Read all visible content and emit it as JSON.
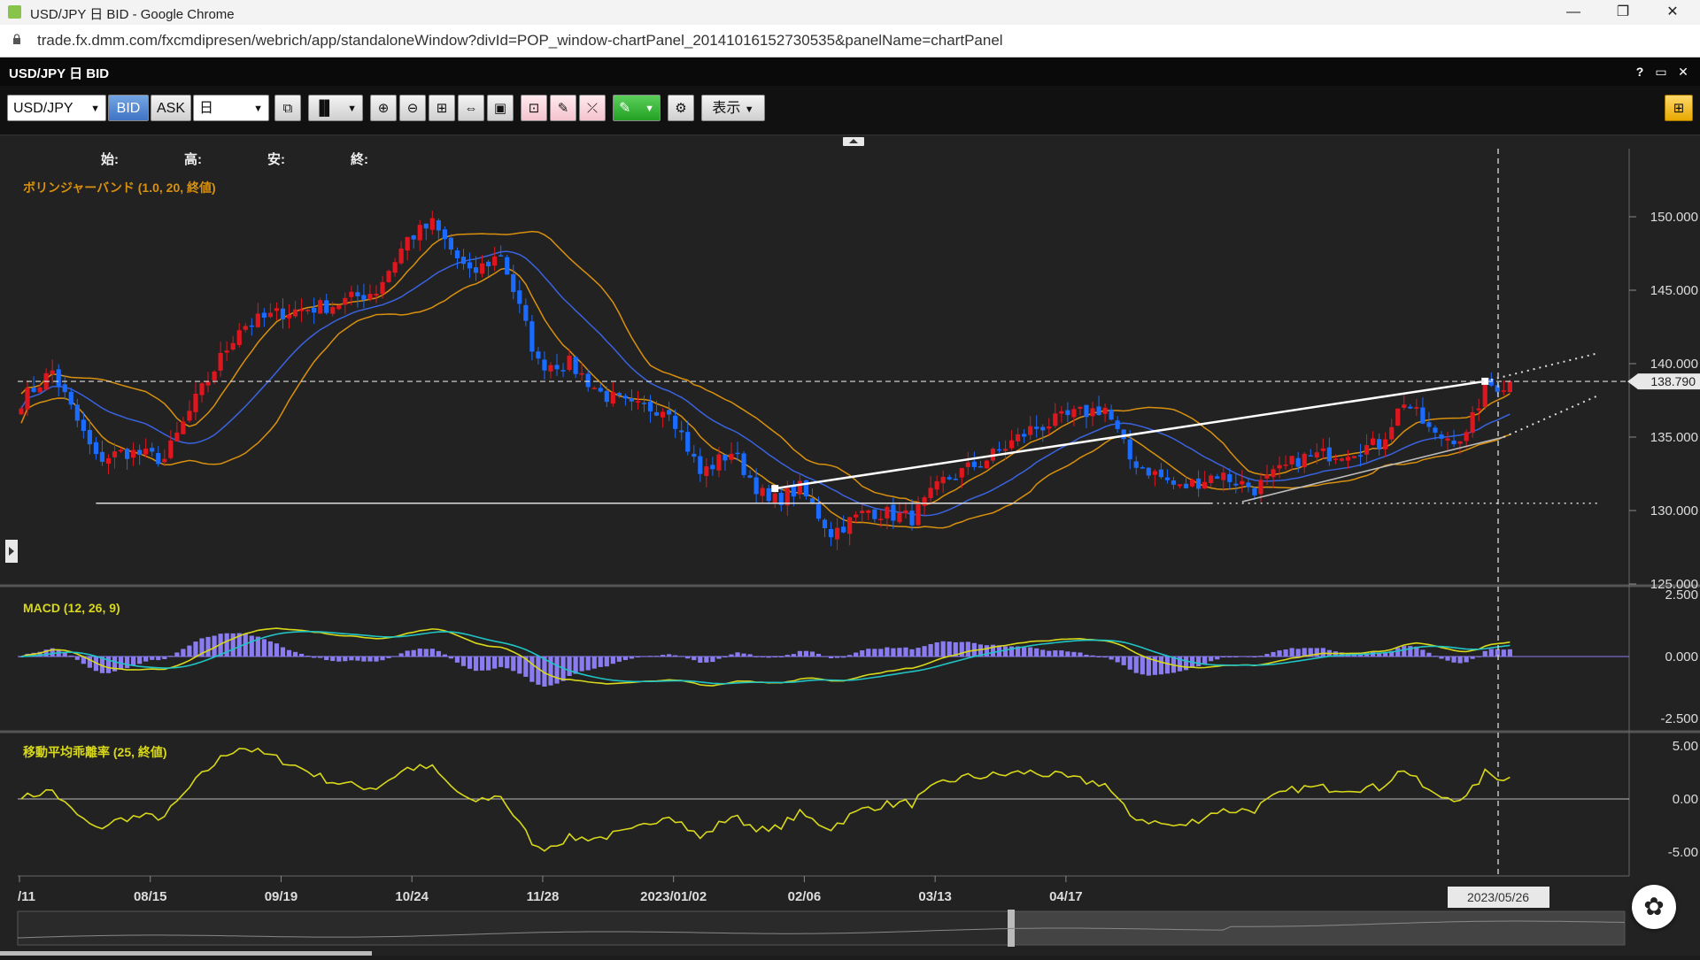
{
  "browser": {
    "window_title": "USD/JPY 日 BID - Google Chrome",
    "url": "trade.fx.dmm.com/fxcmdipresen/webrich/app/standaloneWindow?divId=POP_window-chartPanel_20141016152730535&panelName=chartPanel",
    "minimize": "—",
    "restore": "❐",
    "close": "✕"
  },
  "app": {
    "title": "USD/JPY 日 BID",
    "help": "?",
    "maximize": "▭",
    "close": "✕"
  },
  "toolbar": {
    "symbol": "USD/JPY",
    "bid_label": "BID",
    "ask_label": "ASK",
    "timeframe": "日",
    "display_label": "表示"
  },
  "ohlc": {
    "open_label": "始:",
    "high_label": "高:",
    "low_label": "安:",
    "close_label": "終:"
  },
  "colors": {
    "up": "#e0161f",
    "down": "#1a6bff",
    "ma": "#3a63e0",
    "bands": "#d8900e",
    "macd": "#d8d81a",
    "signal": "#20c4c4",
    "hist": "#8a7cf0",
    "deviation": "#d8d81a"
  },
  "chart_data": [
    {
      "type": "candlestick",
      "indicator": "ボリンジャーバンド (1.0, 20, 終値)",
      "ylim": [
        125,
        152
      ],
      "yticks": [
        "150.000",
        "145.000",
        "140.000",
        "135.000",
        "130.000",
        "125.000"
      ],
      "current_price_label": "138.790",
      "current_price": 138.79,
      "xticks": [
        "/11",
        "08/15",
        "09/19",
        "10/24",
        "11/28",
        "2023/01/02",
        "02/06",
        "03/13",
        "04/17"
      ],
      "cursor_date_label": "2023/05/26",
      "close_anchors": [
        {
          "d": 0,
          "v": 137.5
        },
        {
          "d": 5,
          "v": 139.5
        },
        {
          "d": 12,
          "v": 133.5
        },
        {
          "d": 17,
          "v": 134.0
        },
        {
          "d": 23,
          "v": 133.5
        },
        {
          "d": 28,
          "v": 137.5
        },
        {
          "d": 35,
          "v": 142.5
        },
        {
          "d": 42,
          "v": 143.5
        },
        {
          "d": 50,
          "v": 144.0
        },
        {
          "d": 57,
          "v": 145.0
        },
        {
          "d": 62,
          "v": 148.5
        },
        {
          "d": 66,
          "v": 149.5
        },
        {
          "d": 72,
          "v": 146.0
        },
        {
          "d": 77,
          "v": 147.5
        },
        {
          "d": 83,
          "v": 140.0
        },
        {
          "d": 88,
          "v": 140.0
        },
        {
          "d": 93,
          "v": 138.0
        },
        {
          "d": 98,
          "v": 137.0
        },
        {
          "d": 104,
          "v": 137.0
        },
        {
          "d": 109,
          "v": 132.5
        },
        {
          "d": 114,
          "v": 134.0
        },
        {
          "d": 120,
          "v": 130.5
        },
        {
          "d": 125,
          "v": 131.5
        },
        {
          "d": 130,
          "v": 128.5
        },
        {
          "d": 136,
          "v": 130.0
        },
        {
          "d": 143,
          "v": 129.5
        },
        {
          "d": 148,
          "v": 132.0
        },
        {
          "d": 155,
          "v": 133.5
        },
        {
          "d": 162,
          "v": 135.5
        },
        {
          "d": 169,
          "v": 136.5
        },
        {
          "d": 174,
          "v": 137.0
        },
        {
          "d": 178,
          "v": 133.5
        },
        {
          "d": 186,
          "v": 131.5
        },
        {
          "d": 192,
          "v": 132.5
        },
        {
          "d": 198,
          "v": 131.5
        },
        {
          "d": 205,
          "v": 133.5
        },
        {
          "d": 212,
          "v": 134.0
        },
        {
          "d": 218,
          "v": 134.5
        },
        {
          "d": 222,
          "v": 137.5
        },
        {
          "d": 227,
          "v": 135.0
        },
        {
          "d": 232,
          "v": 135.0
        },
        {
          "d": 235,
          "v": 138.5
        }
      ],
      "horizontal_line": 130.5,
      "trendlines": [
        {
          "from": {
            "d": 121,
            "v": 131.5
          },
          "to": {
            "d": 235,
            "v": 138.8
          },
          "extend_to_d": 253,
          "extend_v": 140.7
        },
        {
          "from": {
            "d": 196,
            "v": 130.6
          },
          "to": {
            "d": 238,
            "v": 135.0
          },
          "extend_to_d": 253,
          "extend_v": 137.8
        }
      ]
    },
    {
      "type": "line",
      "indicator": "MACD (12, 26, 9)",
      "ylim": [
        -2.5,
        2.5
      ],
      "yticks": [
        "2.500",
        "0.000",
        "-2.500"
      ]
    },
    {
      "type": "line",
      "indicator": "移動平均乖離率 (25, 終値)",
      "ylim": [
        -5,
        5
      ],
      "yticks": [
        "5.00",
        "0.00",
        "-5.00"
      ]
    }
  ]
}
